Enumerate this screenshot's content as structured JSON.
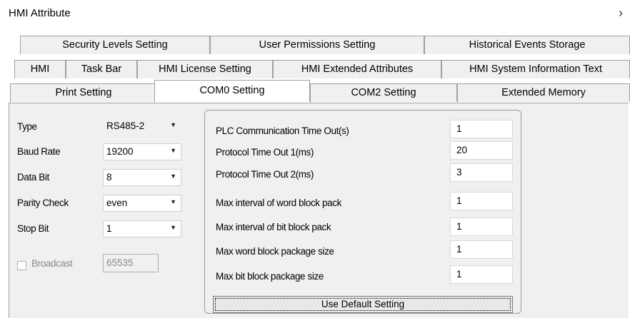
{
  "window": {
    "title": "HMI Attribute",
    "scroll_right_symbol": "›"
  },
  "tabs": {
    "row1": [
      "Security Levels Setting",
      "User Permissions Setting",
      "Historical Events Storage"
    ],
    "row2": [
      "HMI",
      "Task Bar",
      "HMI License Setting",
      "HMI Extended Attributes",
      "HMI System Information Text"
    ],
    "row3": [
      "Print Setting",
      "COM0 Setting",
      "COM2 Setting",
      "Extended Memory"
    ],
    "selected": "COM0 Setting"
  },
  "com": {
    "type": {
      "label": "Type",
      "value": "RS485-2"
    },
    "baud_rate": {
      "label": "Baud Rate",
      "value": "19200"
    },
    "data_bit": {
      "label": "Data Bit",
      "value": "8"
    },
    "parity": {
      "label": "Parity Check",
      "value": "even"
    },
    "stop_bit": {
      "label": "Stop Bit",
      "value": "1"
    },
    "broadcast": {
      "label": "Broadcast",
      "value": "65535",
      "checked": false
    },
    "dropdown_arrow": "▼"
  },
  "protocol": {
    "fields": [
      {
        "label": "PLC Communication Time Out(s)",
        "value": "1"
      },
      {
        "label": "Protocol Time Out 1(ms)",
        "value": "20"
      },
      {
        "label": "Protocol Time Out 2(ms)",
        "value": "3"
      },
      {
        "label": "Max interval of word block pack",
        "value": "1"
      },
      {
        "label": "Max interval of bit block pack",
        "value": "1"
      },
      {
        "label": "Max word block package size",
        "value": "1"
      },
      {
        "label": "Max bit block package size",
        "value": "1"
      }
    ],
    "default_button": "Use Default Setting"
  }
}
